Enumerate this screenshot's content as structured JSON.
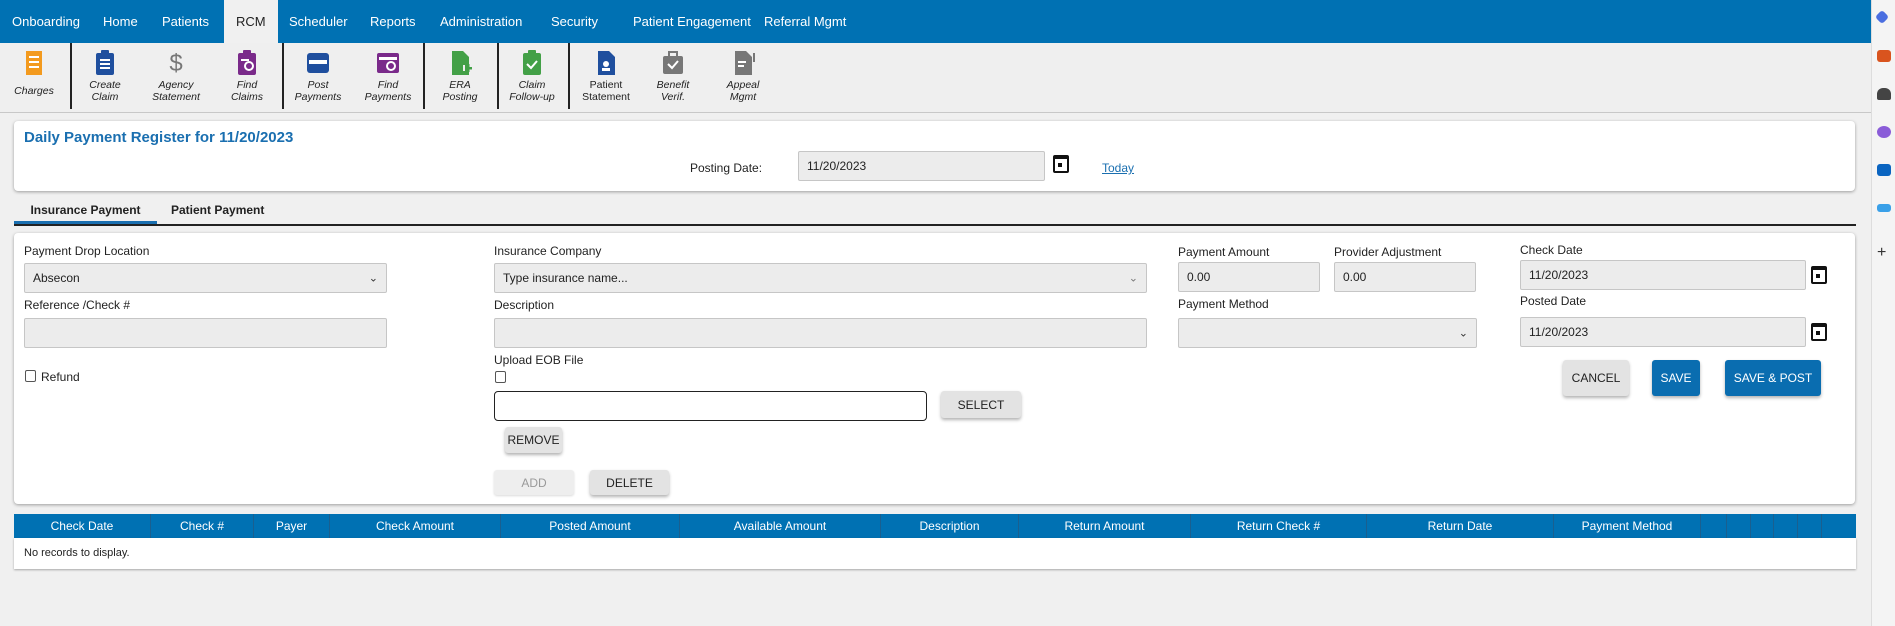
{
  "nav": {
    "items": [
      {
        "label": "Onboarding"
      },
      {
        "label": "Home"
      },
      {
        "label": "Patients"
      },
      {
        "label": "RCM",
        "active": true
      },
      {
        "label": "Scheduler"
      },
      {
        "label": "Reports"
      },
      {
        "label": "Administration"
      },
      {
        "label": "Security"
      },
      {
        "label": "Patient Engagement"
      },
      {
        "label": "Referral Mgmt"
      }
    ]
  },
  "toolbar": {
    "items": [
      {
        "line1": "Charges",
        "line2": "",
        "icon": "charges-icon",
        "color": "#f39a1e"
      },
      {
        "line1": "Create",
        "line2": "Claim",
        "icon": "clipboard-icon",
        "color": "#1f4f9e"
      },
      {
        "line1": "Agency",
        "line2": "Statement",
        "icon": "dollar-icon",
        "color": "#777777"
      },
      {
        "line1": "Find",
        "line2": "Claims",
        "icon": "find-claims-icon",
        "color": "#7a2a8a"
      },
      {
        "line1": "Post",
        "line2": "Payments",
        "icon": "card-icon",
        "color": "#1f4f9e"
      },
      {
        "line1": "Find",
        "line2": "Payments",
        "icon": "find-payments-icon",
        "color": "#7a2a8a"
      },
      {
        "line1": "ERA",
        "line2": "Posting",
        "icon": "file-plus-icon",
        "color": "#43a047"
      },
      {
        "line1": "Claim",
        "line2": "Follow-up",
        "icon": "clipboard-check-icon",
        "color": "#43a047"
      },
      {
        "line1": "Patient",
        "line2": "Statement",
        "icon": "patient-file-icon",
        "color": "#1f4f9e"
      },
      {
        "line1": "Benefit",
        "line2": "Verif.",
        "icon": "briefcase-check-icon",
        "color": "#777777"
      },
      {
        "line1": "Appeal",
        "line2": "Mgmt",
        "icon": "file-alert-icon",
        "color": "#777777"
      }
    ]
  },
  "header": {
    "title": "Daily Payment Register for 11/20/2023",
    "posting_date_label": "Posting Date:",
    "posting_date": "11/20/2023",
    "today_link": "Today"
  },
  "tabs": [
    {
      "label": "Insurance Payment",
      "active": true
    },
    {
      "label": "Patient Payment"
    }
  ],
  "form": {
    "drop_location_label": "Payment Drop Location",
    "drop_location_value": "Absecon",
    "reference_label": "Reference /Check #",
    "reference_value": "",
    "refund_label": "Refund",
    "insurance_label": "Insurance Company",
    "insurance_placeholder": "Type insurance name...",
    "description_label": "Description",
    "description_value": "",
    "upload_label": "Upload EOB File",
    "select_button": "SELECT",
    "remove_button": "REMOVE",
    "add_button": "ADD",
    "delete_button": "DELETE",
    "payment_amount_label": "Payment Amount",
    "payment_amount": "0.00",
    "provider_adjustment_label": "Provider Adjustment",
    "provider_adjustment": "0.00",
    "payment_method_label": "Payment Method",
    "payment_method": "",
    "check_date_label": "Check Date",
    "check_date": "11/20/2023",
    "posted_date_label": "Posted Date",
    "posted_date": "11/20/2023",
    "cancel_button": "CANCEL",
    "save_button": "SAVE",
    "save_post_button": "SAVE & POST"
  },
  "grid": {
    "columns": [
      "Check Date",
      "Check #",
      "Payer",
      "Check Amount",
      "Posted Amount",
      "Available Amount",
      "Description",
      "Return Amount",
      "Return Check #",
      "Return Date",
      "Payment Method",
      "",
      "",
      "",
      "",
      "",
      ""
    ],
    "empty_text": "No records to display."
  },
  "colors": {
    "primary": "#0071b3",
    "button_blue": "#0a6db0"
  }
}
